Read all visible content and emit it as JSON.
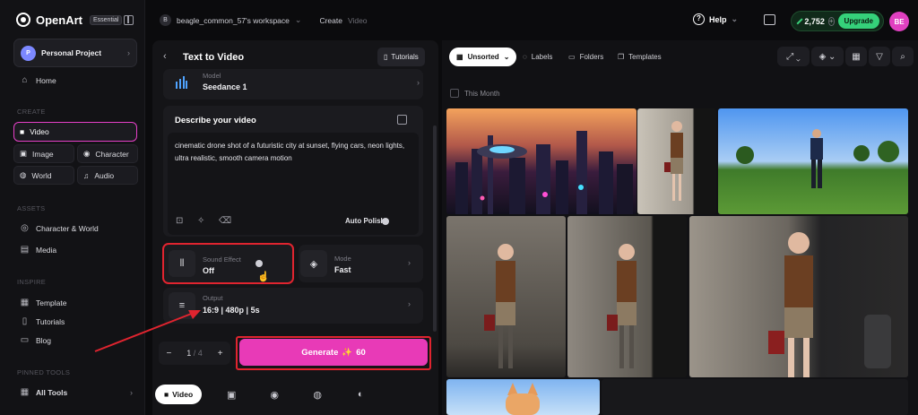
{
  "app": {
    "brand": "OpenArt",
    "plan_badge": "Essential"
  },
  "sidebar": {
    "project": {
      "avatar": "P",
      "label": "Personal Project"
    },
    "home": "Home",
    "sections": {
      "create": "CREATE",
      "assets": "ASSETS",
      "inspire": "INSPIRE",
      "pinned": "PINNED TOOLS"
    },
    "create_items": {
      "video": "Video",
      "image": "Image",
      "character": "Character",
      "world": "World",
      "audio": "Audio"
    },
    "assets_items": {
      "character_world": "Character & World",
      "media": "Media"
    },
    "inspire_items": {
      "template": "Template",
      "tutorials": "Tutorials",
      "blog": "Blog"
    },
    "all_tools": "All Tools"
  },
  "topbar": {
    "workspace_initial": "B",
    "workspace": "beagle_common_57's workspace",
    "crumb_create": "Create",
    "crumb_video": "Video",
    "help": "Help",
    "credits": "2,752",
    "upgrade": "Upgrade",
    "user_initials": "BE"
  },
  "panel": {
    "title": "Text to Video",
    "tutorials": "Tutorials",
    "model_label": "Model",
    "model_value": "Seedance 1",
    "describe_label": "Describe your video",
    "prompt": "cinematic drone shot of a futuristic city at sunset, flying cars, neon lights, ultra realistic, smooth camera motion",
    "auto_polish": "Auto Polish",
    "sound_label": "Sound Effect",
    "sound_value": "Off",
    "mode_label": "Mode",
    "mode_value": "Fast",
    "output_label": "Output",
    "output_value": "16:9 | 480p | 5s",
    "count_value": "1",
    "count_total": "/ 4",
    "generate_label": "Generate",
    "generate_cost": "60",
    "tab_video": "Video"
  },
  "gallery": {
    "sort": "Unsorted",
    "labels": "Labels",
    "folders": "Folders",
    "templates": "Templates",
    "month": "This Month"
  },
  "colors": {
    "accent": "#e83ab7",
    "highlight_box": "#e0242f",
    "credits_green": "#35d17a"
  }
}
